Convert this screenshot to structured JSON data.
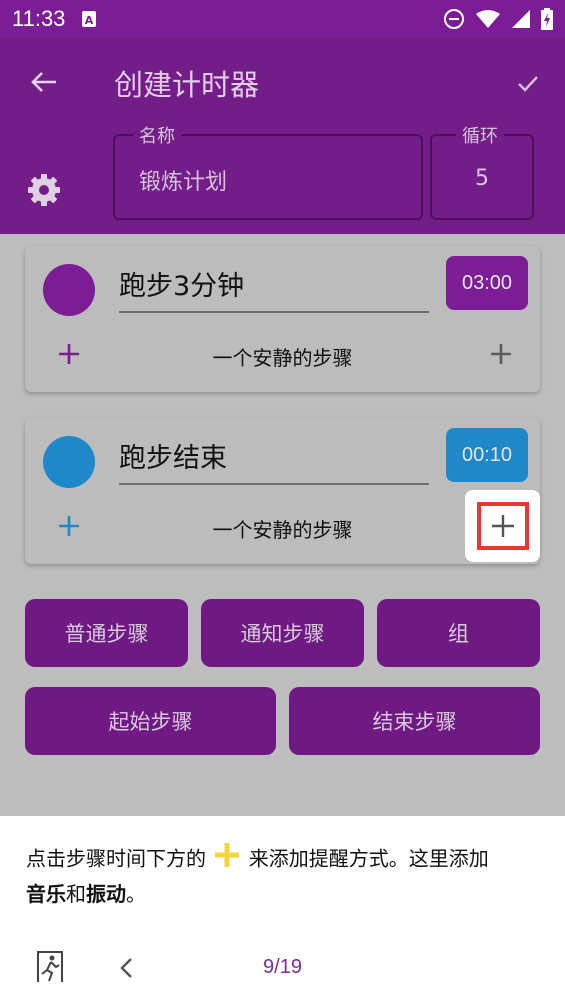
{
  "status_bar": {
    "time": "11:33",
    "icons": [
      "a-box-notification-icon",
      "do-not-disturb-icon",
      "wifi-icon",
      "cell-signal-icon",
      "battery-charging-icon"
    ]
  },
  "app_bar": {
    "title": "创建计时器",
    "name_label": "名称",
    "name_value": "锻炼计划",
    "loop_label": "循环",
    "loop_value": "5"
  },
  "steps": [
    {
      "name": "跑步3分钟",
      "time": "03:00",
      "note": "一个安静的步骤",
      "color": "#7b1d94",
      "badge_color": "#7b1d94",
      "plus_color": "#7b1d94"
    },
    {
      "name": "跑步结束",
      "time": "00:10",
      "note": "一个安静的步骤",
      "color": "#1e88c8",
      "badge_color": "#1e88c8",
      "plus_color": "#1e88c8"
    }
  ],
  "actions": {
    "normal_step": "普通步骤",
    "notify_step": "通知步骤",
    "group": "组",
    "start_step": "起始步骤",
    "end_step": "结束步骤"
  },
  "tutorial": {
    "text_before": "点击步骤时间下方的",
    "text_after": "来添加提醒方式。这里添加",
    "bold1": "音乐",
    "connector": "和",
    "bold2": "振动",
    "end": "。",
    "page": "9/19"
  },
  "colors": {
    "primary": "#7b1d94",
    "accent_blue": "#1e88c8",
    "highlight_red": "#e53935",
    "sparkle_yellow": "#f5d442"
  }
}
